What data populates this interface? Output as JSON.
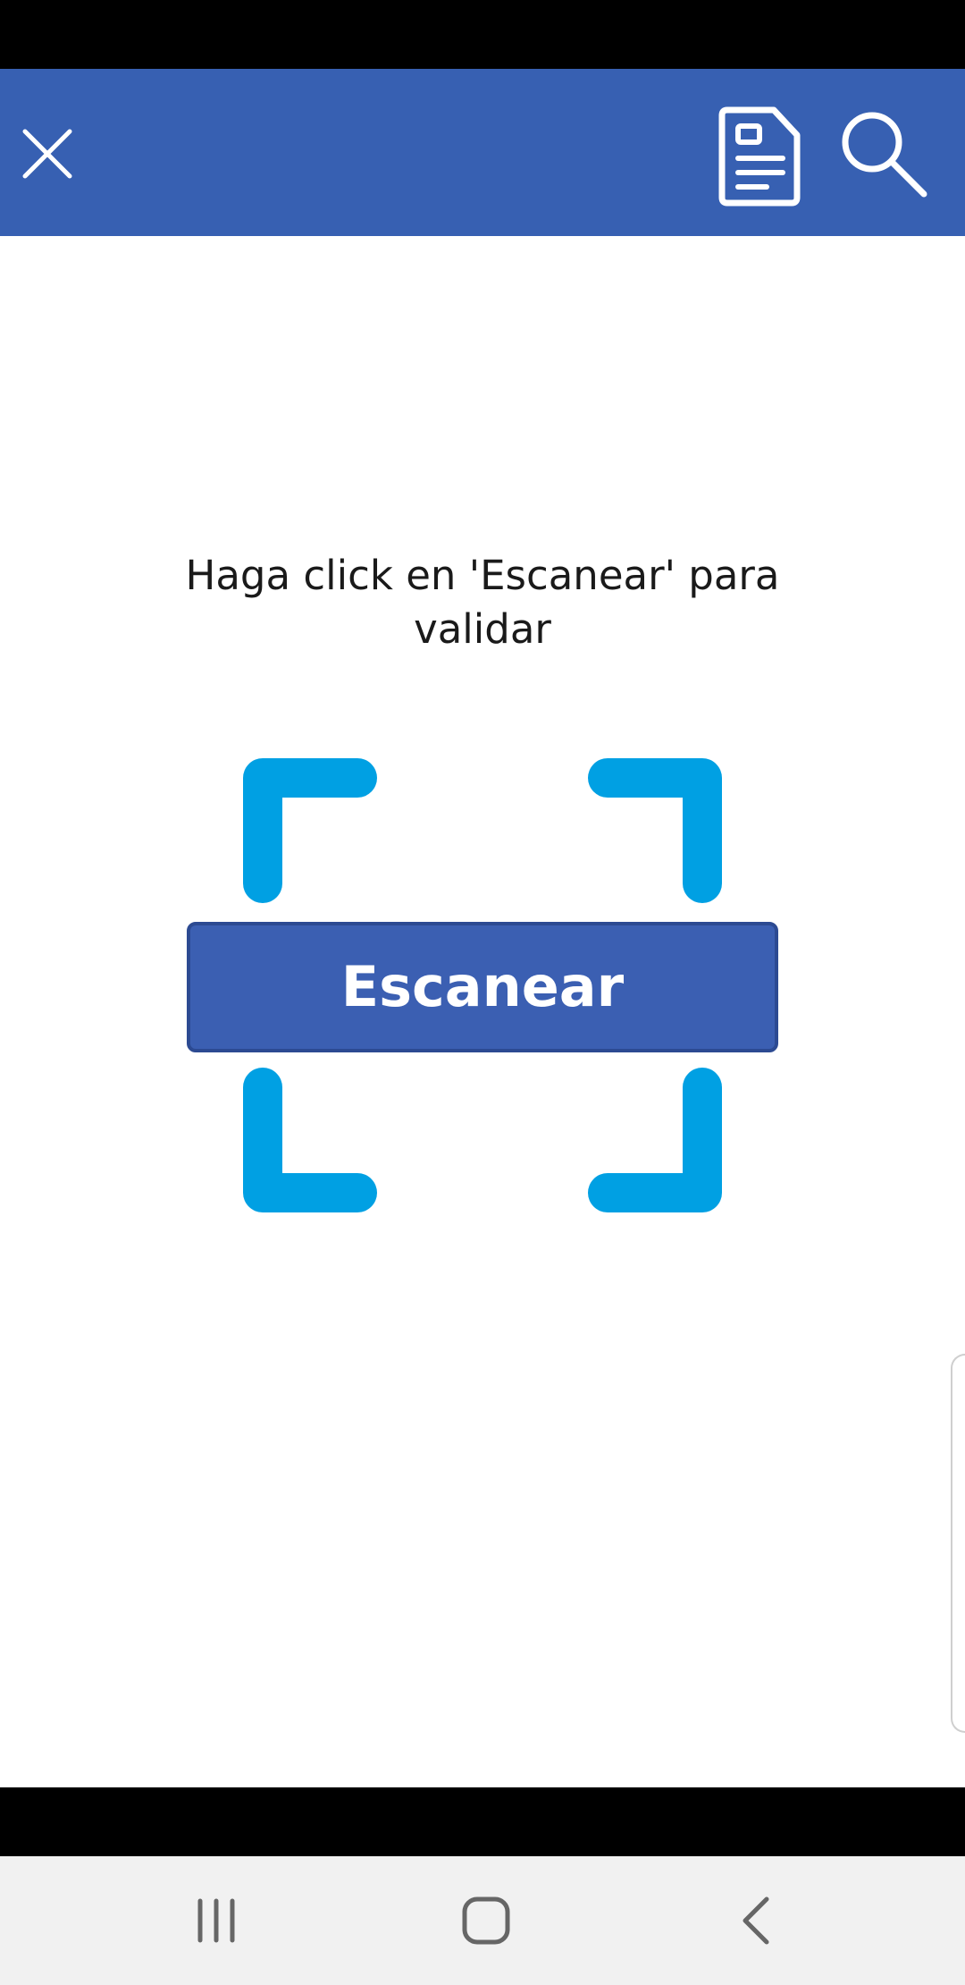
{
  "header": {
    "background_color": "#3760b2",
    "close_icon": "close-icon",
    "document_icon": "document-icon",
    "search_icon": "search-icon"
  },
  "main": {
    "instruction": "Haga click en 'Escanear' para validar",
    "scan_button_label": "Escanear",
    "scan_button_color": "#3b5fb2",
    "frame_color": "#00a0e3"
  },
  "nav": {
    "recents_icon": "recents-icon",
    "home_icon": "home-icon",
    "back_icon": "back-icon"
  }
}
